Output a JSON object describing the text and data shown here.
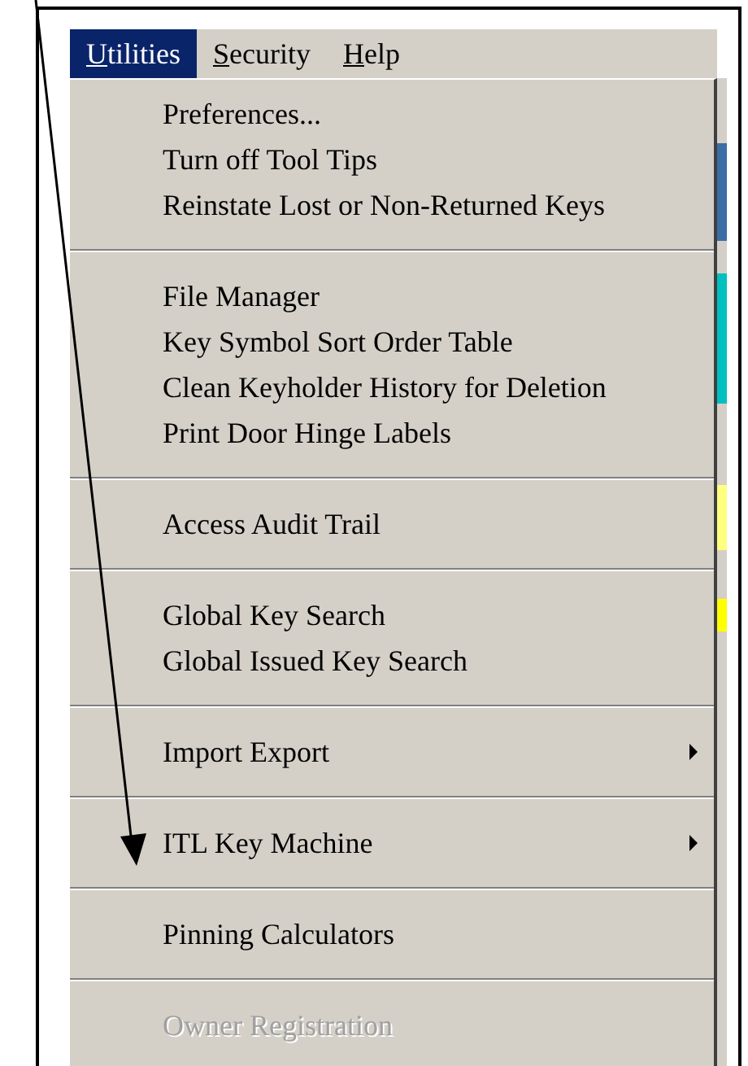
{
  "menu_bar": [
    {
      "mnemonic": "U",
      "rest": "tilities",
      "selected": true
    },
    {
      "mnemonic": "S",
      "rest": "ecurity",
      "selected": false
    },
    {
      "mnemonic": "H",
      "rest": "elp",
      "selected": false
    }
  ],
  "dropdown": {
    "groups": [
      {
        "items": [
          {
            "label": "Preferences...",
            "submenu": false,
            "disabled": false
          },
          {
            "label": "Turn off Tool Tips",
            "submenu": false,
            "disabled": false
          },
          {
            "label": "Reinstate Lost or Non-Returned Keys",
            "submenu": false,
            "disabled": false
          }
        ]
      },
      {
        "items": [
          {
            "label": "File Manager",
            "submenu": false,
            "disabled": false
          },
          {
            "label": "Key Symbol Sort Order Table",
            "submenu": false,
            "disabled": false
          },
          {
            "label": "Clean Keyholder History for Deletion",
            "submenu": false,
            "disabled": false
          },
          {
            "label": "Print Door Hinge Labels",
            "submenu": false,
            "disabled": false
          }
        ]
      },
      {
        "items": [
          {
            "label": "Access Audit Trail",
            "submenu": false,
            "disabled": false
          }
        ]
      },
      {
        "items": [
          {
            "label": "Global Key Search",
            "submenu": false,
            "disabled": false
          },
          {
            "label": "Global Issued Key Search",
            "submenu": false,
            "disabled": false
          }
        ]
      },
      {
        "items": [
          {
            "label": "Import Export",
            "submenu": true,
            "disabled": false
          }
        ]
      },
      {
        "items": [
          {
            "label": "ITL Key Machine",
            "submenu": true,
            "disabled": false
          }
        ]
      },
      {
        "items": [
          {
            "label": "Pinning Calculators",
            "submenu": false,
            "disabled": false
          }
        ]
      },
      {
        "items": [
          {
            "label": "Owner Registration",
            "submenu": false,
            "disabled": true
          }
        ]
      }
    ]
  }
}
